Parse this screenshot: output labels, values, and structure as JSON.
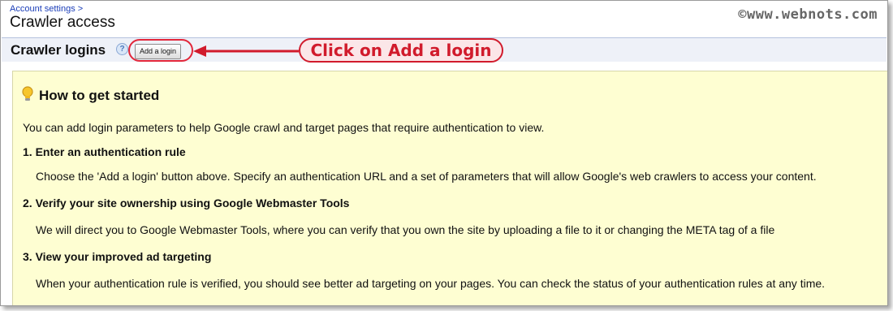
{
  "breadcrumb": {
    "link": "Account settings",
    "separator": ">"
  },
  "page_title": "Crawler access",
  "watermark": "©www.webnots.com",
  "section": {
    "title": "Crawler logins",
    "help_icon": "question-mark",
    "add_button_label": "Add a login"
  },
  "annotation": {
    "callout_text": "Click on Add a login",
    "color": "#d11b2c"
  },
  "panel": {
    "heading": "How to get started",
    "heading_icon": "lightbulb",
    "background": "#fefed2",
    "intro": "You can add login parameters to help Google crawl and target pages that require authentication to view.",
    "steps": [
      {
        "number": "1.",
        "title": "Enter an authentication rule",
        "description": "Choose the 'Add a login' button above. Specify an authentication URL and a set of parameters that will allow Google's web crawlers to access your content."
      },
      {
        "number": "2.",
        "title": "Verify your site ownership using Google Webmaster Tools",
        "description": "We will direct you to Google Webmaster Tools, where you can verify that you own the site by uploading a file to it or changing the META tag of a file"
      },
      {
        "number": "3.",
        "title": "View your improved ad targeting",
        "description": "When your authentication rule is verified, you should see better ad targeting on your pages. You can check the status of your authentication rules at any time."
      }
    ]
  }
}
